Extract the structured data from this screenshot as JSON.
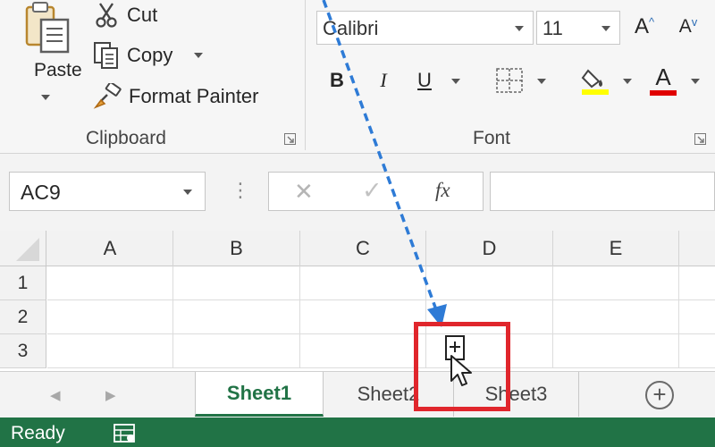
{
  "clipboard": {
    "paste_label": "Paste",
    "cut_label": "Cut",
    "copy_label": "Copy",
    "format_painter_label": "Format Painter",
    "group_label": "Clipboard"
  },
  "font": {
    "font_name": "Calibri",
    "font_size": "11",
    "grow_label": "A",
    "shrink_label": "A",
    "bold_label": "B",
    "italic_label": "I",
    "underline_label": "U",
    "font_color_label": "A",
    "group_label": "Font"
  },
  "formula_bar": {
    "name_box": "AC9",
    "separator": "⋮",
    "cancel": "✕",
    "enter": "✓",
    "fx": "fx",
    "formula_value": ""
  },
  "columns": [
    "A",
    "B",
    "C",
    "D",
    "E"
  ],
  "rows": [
    "1",
    "2",
    "3"
  ],
  "sheets": [
    "Sheet1",
    "Sheet2",
    "Sheet3"
  ],
  "active_sheet": "Sheet1",
  "status": {
    "ready": "Ready"
  },
  "icons": {
    "paste": "paste-icon",
    "cut": "scissors-icon",
    "copy": "copy-icon",
    "format_painter": "paintbrush-icon",
    "borders": "borders-icon",
    "fill": "fill-bucket-icon",
    "drag_cursor": "copy-drag-cursor-icon"
  },
  "colors": {
    "excel_green": "#217346",
    "highlight_box": "#e0262c",
    "drag_arrow": "#2e7bd6",
    "fill_color": "#ffff00",
    "font_color": "#e00000"
  }
}
